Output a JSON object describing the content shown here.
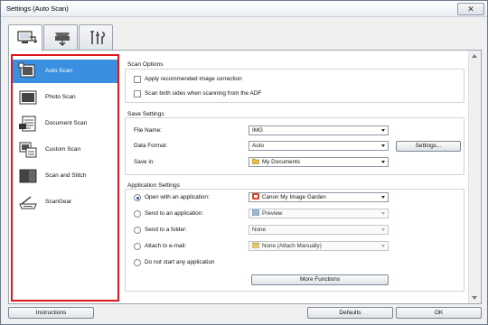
{
  "window": {
    "title": "Settings (Auto Scan)",
    "close_glyph": "✕"
  },
  "tabs": [
    {
      "icon": "scan-from-computer-icon",
      "active": true
    },
    {
      "icon": "scan-from-panel-icon",
      "active": false
    },
    {
      "icon": "general-settings-icon",
      "active": false
    }
  ],
  "sidebar": {
    "items": [
      {
        "label": "Auto Scan",
        "icon": "auto-scan-icon",
        "selected": true
      },
      {
        "label": "Photo Scan",
        "icon": "photo-scan-icon",
        "selected": false
      },
      {
        "label": "Document Scan",
        "icon": "document-scan-icon",
        "selected": false
      },
      {
        "label": "Custom Scan",
        "icon": "custom-scan-icon",
        "selected": false
      },
      {
        "label": "Scan and Stitch",
        "icon": "scan-and-stitch-icon",
        "selected": false
      },
      {
        "label": "ScanGear",
        "icon": "scangear-icon",
        "selected": false
      }
    ]
  },
  "scan_options": {
    "title": "Scan Options",
    "apply_correction": "Apply recommended image correction",
    "scan_both_sides": "Scan both sides when scanning from the ADF"
  },
  "save_settings": {
    "title": "Save Settings",
    "file_name_label": "File Name:",
    "file_name_value": "IMG",
    "data_format_label": "Data Format:",
    "data_format_value": "Auto",
    "settings_button": "Settings...",
    "save_in_label": "Save in:",
    "save_in_value": "My Documents"
  },
  "application_settings": {
    "title": "Application Settings",
    "open_with_app": "Open with an application:",
    "open_with_app_value": "Canon My Image Garden",
    "send_to_app": "Send to an application:",
    "send_to_app_value": "Preview",
    "send_to_folder": "Send to a folder:",
    "send_to_folder_value": "None",
    "attach_email": "Attach to e-mail:",
    "attach_email_value": "None (Attach Manually)",
    "do_not_start": "Do not start any application",
    "more_functions": "More Functions"
  },
  "footer": {
    "instructions": "Instructions",
    "defaults": "Defaults",
    "ok": "OK"
  },
  "colors": {
    "selection": "#3a8fe0",
    "highlight_border": "#e0161d"
  }
}
